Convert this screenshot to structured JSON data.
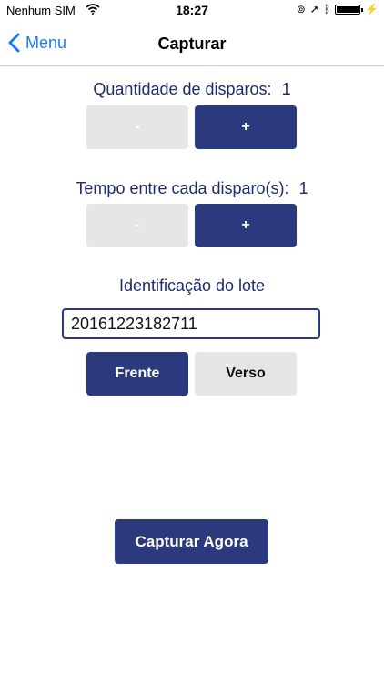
{
  "status_bar": {
    "carrier": "Nenhum SIM",
    "time": "18:27",
    "icons": [
      "wifi-icon",
      "orientation-lock-icon",
      "location-icon",
      "bluetooth-icon",
      "battery-icon",
      "charging-icon"
    ]
  },
  "nav": {
    "back_label": "Menu",
    "title": "Capturar"
  },
  "shots": {
    "label": "Quantidade de disparos:",
    "value": "1",
    "minus": "-",
    "plus": "+"
  },
  "interval": {
    "label": "Tempo entre cada disparo(s):",
    "value": "1",
    "minus": "-",
    "plus": "+"
  },
  "batch": {
    "label": "Identificação do lote",
    "value": "20161223182711"
  },
  "side": {
    "front": "Frente",
    "back": "Verso",
    "selected": "Frente"
  },
  "capture_button": "Capturar Agora",
  "colors": {
    "navy": "#2b3a7c",
    "label_text": "#1e2a6e",
    "inactive_button": "#e6e6e6",
    "ios_blue": "#1a7aff"
  }
}
